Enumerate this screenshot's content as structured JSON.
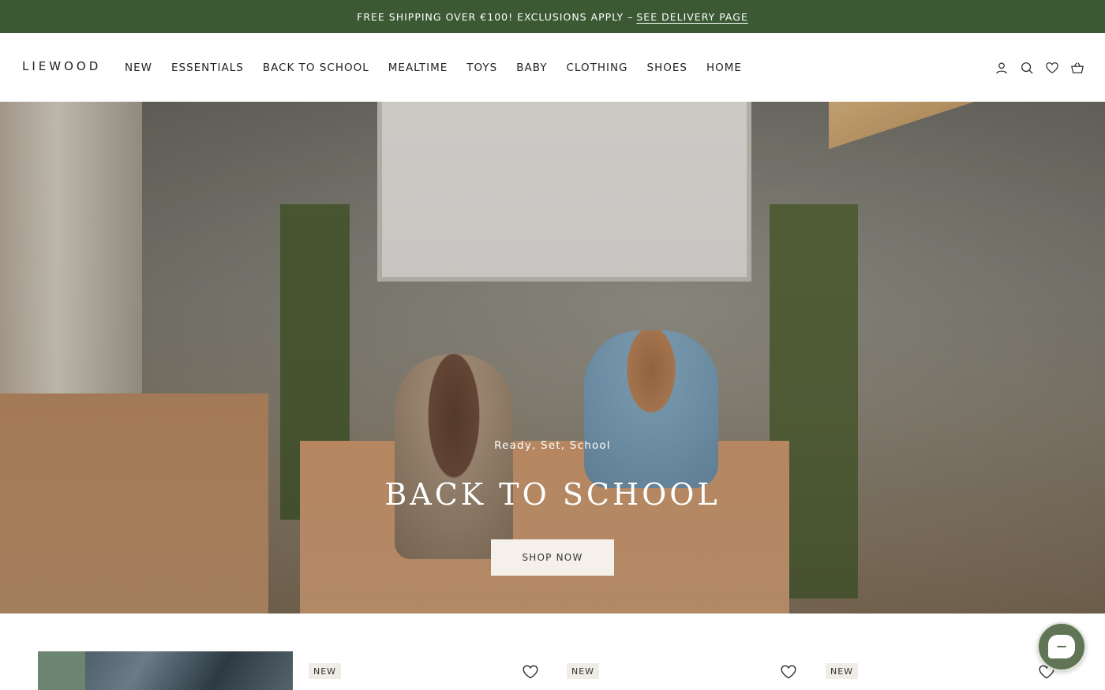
{
  "announcement": {
    "text": "FREE SHIPPING OVER €100! EXCLUSIONS APPLY –",
    "link": "SEE DELIVERY PAGE",
    "bg_color": "#3b5a34"
  },
  "header": {
    "logo": "LIEWOOD",
    "nav": [
      "NEW",
      "ESSENTIALS",
      "BACK TO SCHOOL",
      "MEALTIME",
      "TOYS",
      "BABY",
      "CLOTHING",
      "SHOES",
      "HOME"
    ],
    "icons": [
      "account-icon",
      "search-icon",
      "wishlist-heart-icon",
      "basket-icon"
    ]
  },
  "hero": {
    "eyebrow": "Ready, Set, School",
    "title": "BACK TO SCHOOL",
    "cta": "SHOP NOW"
  },
  "products": {
    "badges": [
      "NEW",
      "NEW",
      "NEW"
    ]
  },
  "chat": {
    "icon": "chat-icon",
    "color": "#5f7556"
  }
}
